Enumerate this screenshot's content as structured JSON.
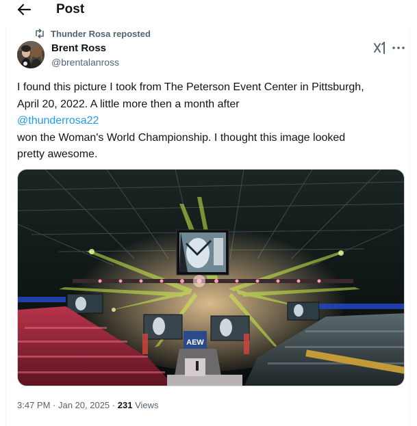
{
  "header": {
    "title": "Post"
  },
  "repost": {
    "label": "Thunder Rosa reposted"
  },
  "author": {
    "name": "Brent Ross",
    "handle": "@brentalanross"
  },
  "tweet": {
    "line1": "I found this picture I took from The Peterson Event Center in Pittsburgh,",
    "line2": "April 20, 2022.  A little more then a month after",
    "mention": "@thunderrosa22",
    "line3": "won the Woman's World Championship.  I thought this image looked",
    "line4": "pretty awesome."
  },
  "media": {
    "screen_logo": "AEW"
  },
  "meta": {
    "time": "3:47 PM",
    "sep1": " · ",
    "date": "Jan 20, 2025",
    "sep2": " · ",
    "views_count": "231",
    "views_label": "Views"
  },
  "icons": {
    "back": "arrow-left-icon",
    "repost": "repost-icon",
    "grok": "grok-icon",
    "more": "more-horizontal-icon"
  },
  "colors": {
    "link": "#1d9bf0",
    "secondary": "#536471",
    "text": "#0f1419"
  }
}
